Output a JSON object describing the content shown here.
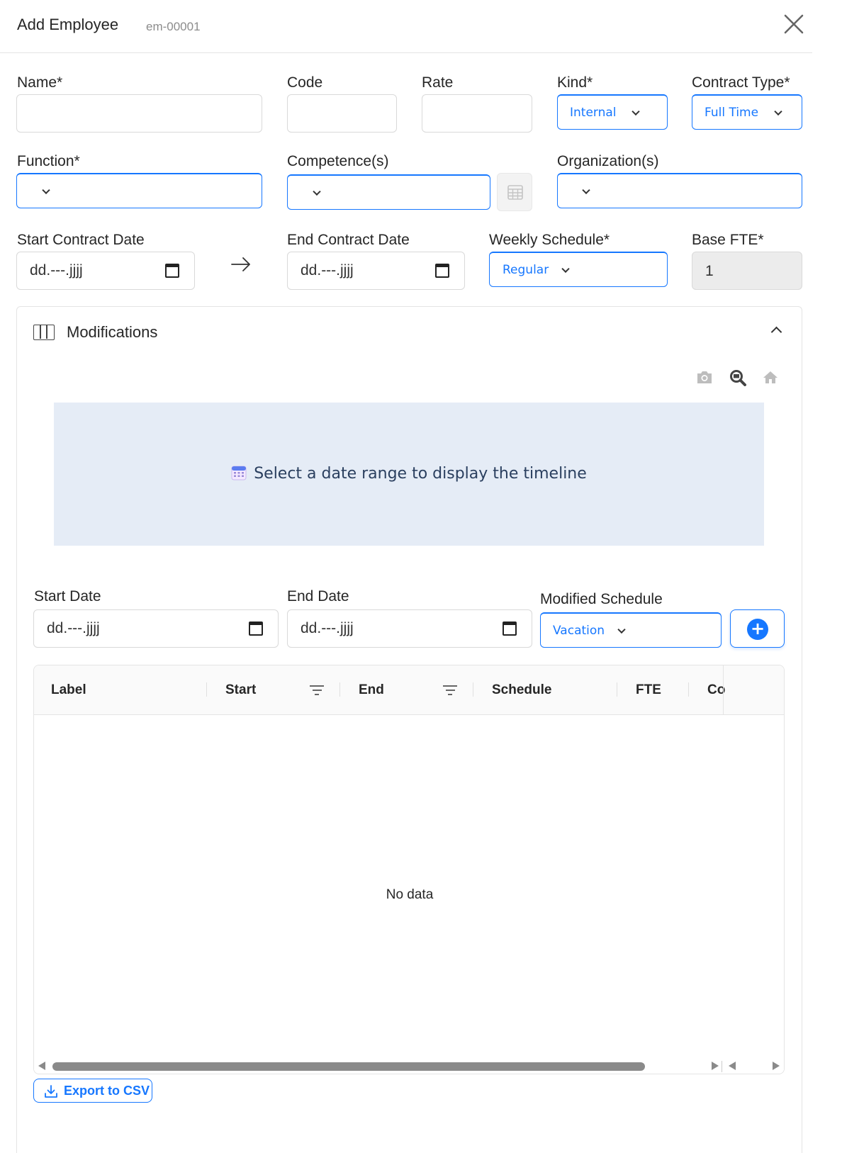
{
  "header": {
    "title": "Add Employee",
    "code": "em-00001"
  },
  "form": {
    "name_label": "Name*",
    "code_label": "Code",
    "rate_label": "Rate",
    "kind_label": "Kind*",
    "kind_value": "Internal",
    "contract_type_label": "Contract Type*",
    "contract_type_value": "Full Time",
    "function_label": "Function*",
    "competence_label": "Competence(s)",
    "organization_label": "Organization(s)",
    "start_contract_label": "Start Contract Date",
    "start_contract_placeholder": "dd.---.jjjj",
    "end_contract_label": "End Contract Date",
    "end_contract_placeholder": "dd.---.jjjj",
    "weekly_schedule_label": "Weekly Schedule*",
    "weekly_schedule_value": "Regular",
    "base_fte_label": "Base FTE*",
    "base_fte_value": "1"
  },
  "modifications": {
    "title": "Modifications",
    "timeline_message": "Select a date range to display the timeline",
    "start_date_label": "Start Date",
    "start_date_placeholder": "dd.---.jjjj",
    "end_date_label": "End Date",
    "end_date_placeholder": "dd.---.jjjj",
    "modified_schedule_label": "Modified Schedule",
    "modified_schedule_value": "Vacation",
    "table": {
      "columns": [
        "Label",
        "Start",
        "End",
        "Schedule",
        "FTE",
        "Co"
      ],
      "empty_text": "No data"
    },
    "export_label": "Export to CSV"
  },
  "colors": {
    "accent": "#1677ff",
    "timeline_bg": "#e5ecf6",
    "timeline_text": "#2a3f5f"
  }
}
